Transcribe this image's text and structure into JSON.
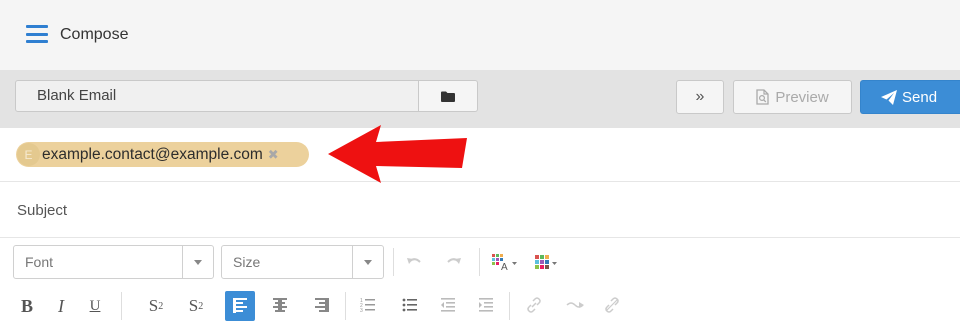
{
  "header": {
    "title": "Compose",
    "menu_icon": "hamburger-icon"
  },
  "toolbar": {
    "template_name": "Blank Email",
    "folder_icon": "folder-icon",
    "more_label": "»",
    "preview_label": "Preview",
    "send_label": "Send"
  },
  "recipients": [
    {
      "initial": "E",
      "email": "example.contact@example.com",
      "remove_icon": "close-icon"
    }
  ],
  "subject": {
    "placeholder": "Subject"
  },
  "editor": {
    "font_placeholder": "Font",
    "size_placeholder": "Size",
    "bold": "B",
    "italic": "I",
    "underline": "U",
    "subscript_base": "S",
    "subscript_mark": "2",
    "superscript_base": "S",
    "superscript_mark": "2"
  },
  "colors": {
    "accent": "#3c8dd6",
    "chip": "#ecd19c",
    "annotation_arrow": "#ee1111"
  }
}
